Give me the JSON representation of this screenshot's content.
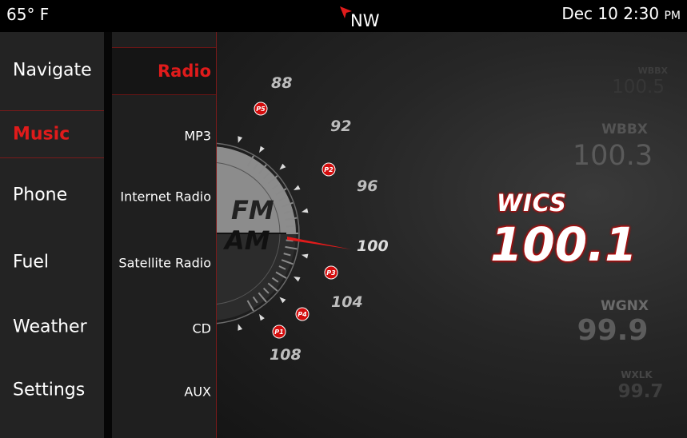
{
  "status": {
    "temperature": "65° F",
    "heading": "NW",
    "date_time": "Dec 10 2:30",
    "ampm": "PM"
  },
  "nav": {
    "items": [
      {
        "label": "Navigate"
      },
      {
        "label": "Music"
      },
      {
        "label": "Phone"
      },
      {
        "label": "Fuel"
      },
      {
        "label": "Weather"
      },
      {
        "label": "Settings"
      }
    ],
    "active": "Music"
  },
  "music_menu": {
    "header": "Radio",
    "items": [
      {
        "label": "MP3"
      },
      {
        "label": "Internet Radio"
      },
      {
        "label": "Satellite Radio"
      },
      {
        "label": "CD"
      },
      {
        "label": "AUX"
      }
    ]
  },
  "tuner": {
    "bands": [
      "FM",
      "AM"
    ],
    "scale": [
      "88",
      "92",
      "96",
      "100",
      "104",
      "108"
    ],
    "presets": [
      "P5",
      "P2",
      "P3",
      "P4",
      "P1"
    ],
    "current_frequency": "100"
  },
  "stations": {
    "above": [
      {
        "call": "WBBX",
        "freq": "100.5"
      },
      {
        "call": "WBBX",
        "freq": "100.3"
      }
    ],
    "current": {
      "call": "WICS",
      "freq": "100.1"
    },
    "below": [
      {
        "call": "WGNX",
        "freq": "99.9"
      },
      {
        "call": "WXLK",
        "freq": "99.7"
      }
    ]
  },
  "colors": {
    "accent": "#e01b1b",
    "preset_badge": "#d30c0c",
    "nav_bg": "#232323",
    "panel_bg": "#1f1f1f"
  }
}
